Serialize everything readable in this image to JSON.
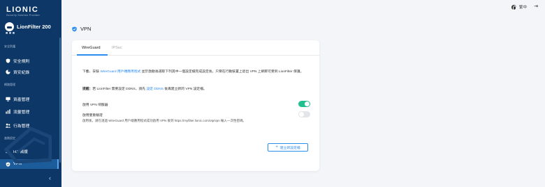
{
  "brand": {
    "logo": "LIONIC",
    "tagline": "Security Solution Provider"
  },
  "device": {
    "name": "LionFilter 200"
  },
  "sidebar": {
    "cut_item": "■ ■ ■",
    "sections": {
      "security": "安全防護",
      "network": "網路管理",
      "advanced": "進階設定"
    },
    "items": [
      {
        "label": "安全規則",
        "icon": "shield-icon"
      },
      {
        "label": "資安紀錄",
        "icon": "log-icon"
      },
      {
        "label": "資產管理",
        "icon": "assets-icon"
      },
      {
        "label": "流量管理",
        "icon": "traffic-icon"
      },
      {
        "label": "行為管理",
        "icon": "behavior-icon"
      },
      {
        "label": "HA 備援",
        "icon": "ha-icon"
      },
      {
        "label": "VPN",
        "icon": "vpn-shield-icon"
      }
    ],
    "active_item": "VPN",
    "collapse_label": "‹"
  },
  "topbar": {
    "language": "繁中",
    "logout_icon": "⇥"
  },
  "page": {
    "title": "VPN"
  },
  "tabs": [
    "WireGuard",
    "IPSec"
  ],
  "active_tab": "WireGuard",
  "content": {
    "desc_prefix": "下載、安裝 ",
    "desc_link": "WireGuard 用戶端應用程式",
    "desc_suffix": " 並於啟動後選取下列其中一個設定檔完成設定後，只要在行動裝置上退出 VPN 上網即可受到 LionFilter 保護。",
    "note_label": "提醒：",
    "note_prefix": "若 LionFilter 需要設定 DDNS，請先 ",
    "note_link": "設定 DDNS",
    "note_suffix": " 後再建立新的 VPN 設定檔。",
    "enable_server_label": "啟用 VPN 伺服器",
    "enable_server": true,
    "enable_otp_label": "啟用雙重驗證",
    "enable_otp": false,
    "otp_hint": "啟用後，請在透過 WireGuard 用戶端應用程式成功啟用 VPN 後到 https://myfilter.lionic.com/otp/vpn 輸入一次性密碼。",
    "add_button": "建立新設定檔",
    "add_icon": "+"
  },
  "colors": {
    "sidebar_bg": "#0c3766",
    "accent": "#2b8cf0",
    "toggle_on": "#1fbf8f"
  }
}
